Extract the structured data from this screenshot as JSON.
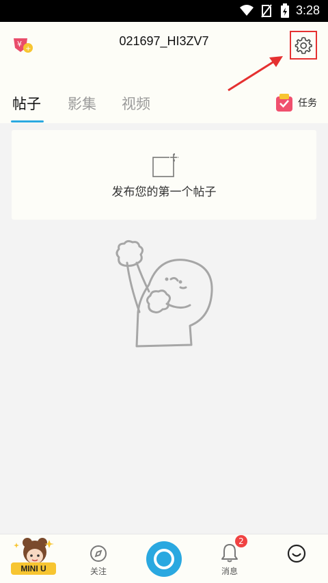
{
  "status_bar": {
    "time": "3:28"
  },
  "header": {
    "title": "021697_HI3ZV7",
    "coin_icon": "coin-badge-icon",
    "settings_icon": "gear-icon",
    "tabs": [
      {
        "label": "帖子",
        "active": true
      },
      {
        "label": "影集",
        "active": false
      },
      {
        "label": "视频",
        "active": false
      }
    ],
    "task_label": "任务"
  },
  "content": {
    "post_prompt": "发布您的第一个帖子"
  },
  "bottom_nav": {
    "items": [
      {
        "label": "MINI U",
        "icon": "avatar-icon"
      },
      {
        "label": "关注",
        "icon": "compass-icon"
      },
      {
        "label": "",
        "icon": "camera-icon"
      },
      {
        "label": "消息",
        "icon": "bell-icon"
      },
      {
        "label": "",
        "icon": "smile-icon"
      }
    ],
    "message_badge": "2"
  },
  "colors": {
    "accent": "#2aa8e0",
    "highlight_box": "#e53030",
    "badge": "#f04242"
  }
}
